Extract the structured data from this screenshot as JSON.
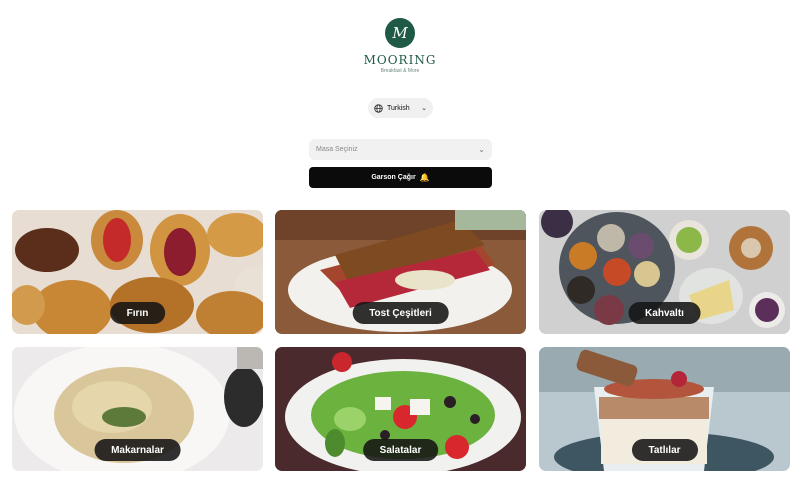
{
  "brand": {
    "badge": "M",
    "name": "MOORING",
    "tagline": "Breakfast & More"
  },
  "language": {
    "icon": "globe-icon",
    "selected": "Turkish"
  },
  "table_select": {
    "placeholder": "Masa Seçiniz"
  },
  "call_waiter": {
    "label": "Garson Çağır",
    "icon": "bell-icon"
  },
  "categories": [
    {
      "label": "Fırın"
    },
    {
      "label": "Tost Çeşitleri"
    },
    {
      "label": "Kahvaltı"
    },
    {
      "label": "Makarnalar"
    },
    {
      "label": "Salatalar"
    },
    {
      "label": "Tatlılar"
    }
  ],
  "colors": {
    "brand": "#1f5a46",
    "button": "#0b0b0b"
  }
}
